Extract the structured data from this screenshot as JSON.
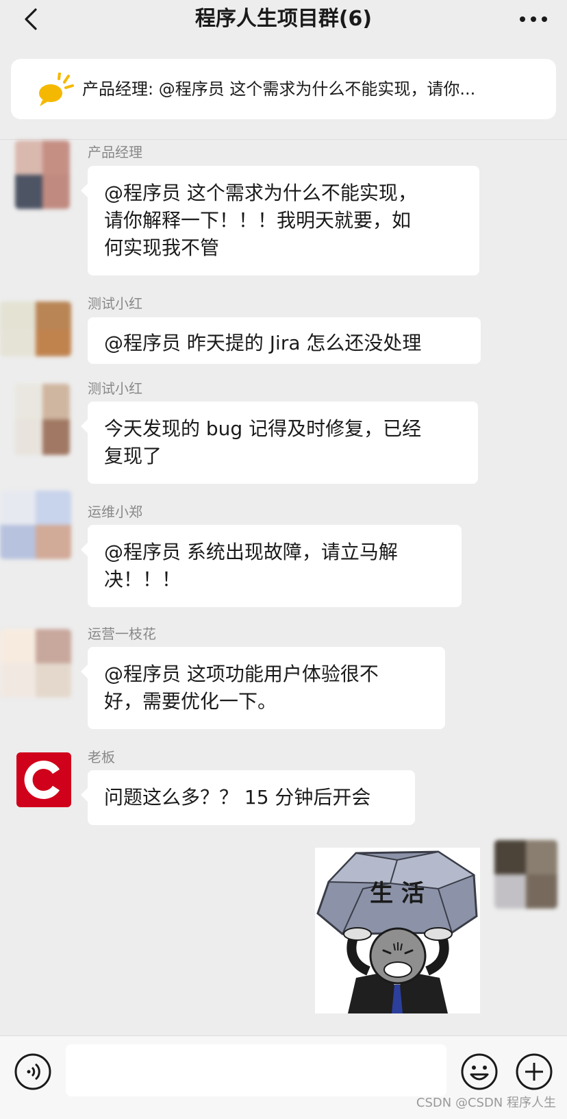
{
  "header": {
    "title": "程序人生项目群(6)",
    "back_icon": "chevron-left-icon",
    "more_icon": "more-dots-icon"
  },
  "notice": {
    "icon": "announcement-icon",
    "text": "产品经理: @程序员 这个需求为什么不能实现，请你...",
    "icon_color": "#f5b800"
  },
  "messages": [
    {
      "sender": "产品经理",
      "text": "@程序员 这个需求为什么不能实现，\n请你解释一下！！！我明天就要，如\n何实现我不管"
    },
    {
      "sender": "测试小红",
      "text": "@程序员 昨天提的 Jira 怎么还没处理"
    },
    {
      "sender": "测试小红",
      "text": "今天发现的 bug 记得及时修复，已经\n复现了"
    },
    {
      "sender": "运维小郑",
      "text": "@程序员 系统出现故障，请立马解\n决！！！"
    },
    {
      "sender": "运营一枝花",
      "text": " @程序员 这项功能用户体验很不\n好，需要优化一下。"
    },
    {
      "sender": "老板",
      "text": "问题这么多？？ 15 分钟后开会",
      "avatar_letter": "C",
      "avatar_color": "#d0021b"
    }
  ],
  "sticker": {
    "text": "生 活",
    "icon": "rock-carrying-sticker"
  },
  "input_bar": {
    "voice_icon": "voice-icon",
    "emoji_icon": "emoji-icon",
    "plus_icon": "plus-icon",
    "placeholder": ""
  },
  "watermark": "CSDN @CSDN 程序人生"
}
